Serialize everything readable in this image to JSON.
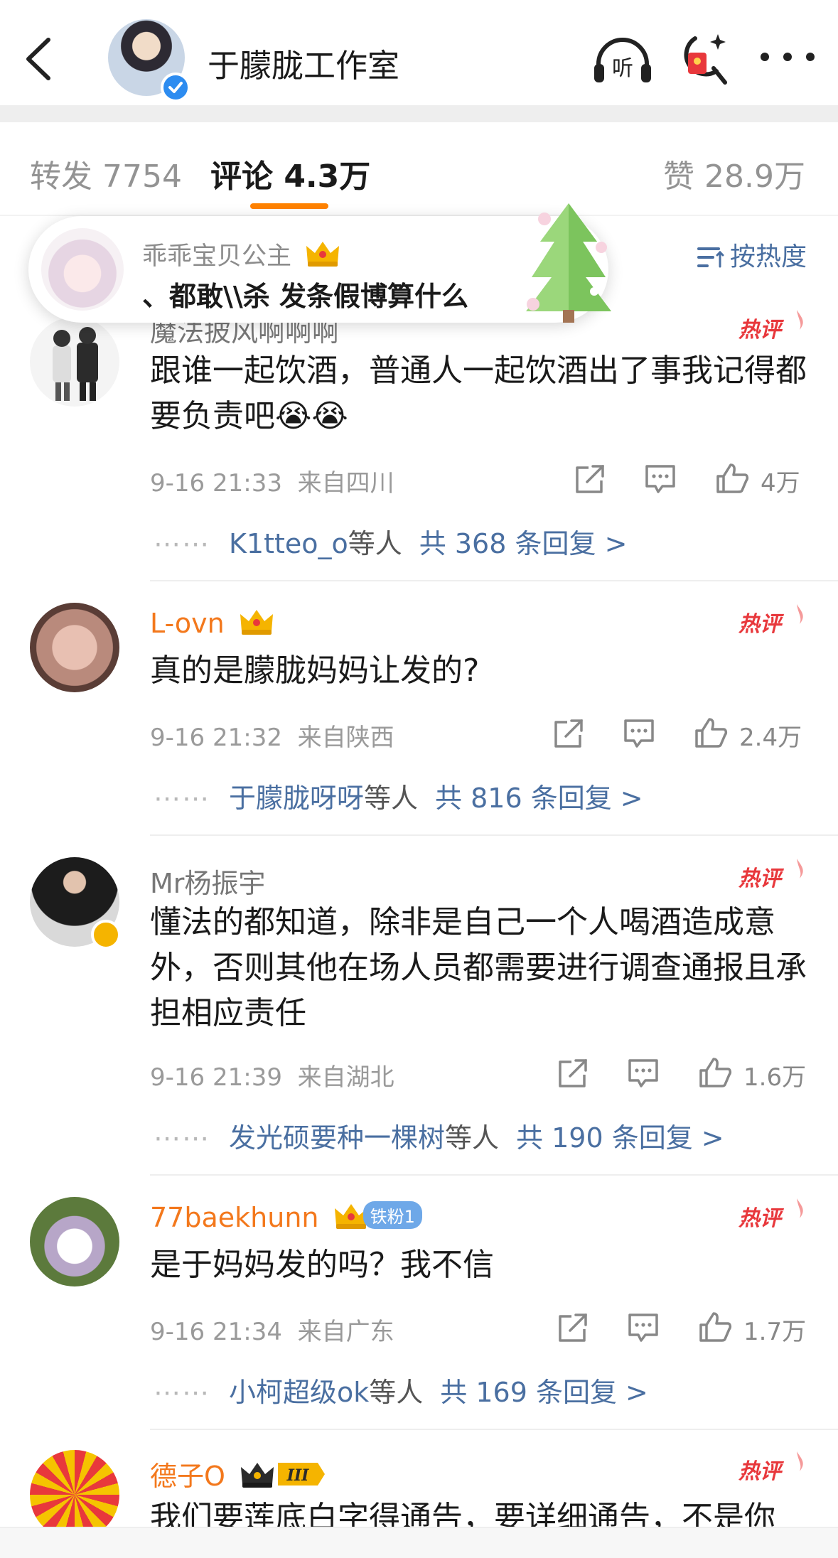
{
  "header": {
    "title": "于朦胧工作室"
  },
  "tabs": {
    "repost": "转发 7754",
    "comment": "评论 4.3万",
    "like": "赞 28.9万"
  },
  "sort": {
    "label": "按热度"
  },
  "bubble": {
    "name": "乖乖宝贝公主",
    "text": "、都敢\\\\杀 发条假博算什么"
  },
  "hot_tag": "热评",
  "comments": [
    {
      "name": "魔法披风啊啊啊",
      "text": "跟谁一起饮酒，普通人一起饮酒出了事我记得都要负责吧😭😭",
      "time": "9-16 21:33",
      "location": "来自四川",
      "likes": "4万",
      "reply_users": "K1tteo_o",
      "reply_suffix": "等人",
      "reply_total": "共 368 条回复 >"
    },
    {
      "name": "L-ovn",
      "text": "真的是朦胧妈妈让发的?",
      "time": "9-16 21:32",
      "location": "来自陕西",
      "likes": "2.4万",
      "reply_users": "于朦胧呀呀",
      "reply_suffix": "等人",
      "reply_total": "共 816 条回复 >"
    },
    {
      "name": "Mr杨振宇",
      "text": "懂法的都知道，除非是自己一个人喝酒造成意外，否则其他在场人员都需要进行调查通报且承担相应责任",
      "time": "9-16 21:39",
      "location": "来自湖北",
      "likes": "1.6万",
      "reply_users": "发光硕要种一棵树",
      "reply_suffix": "等人",
      "reply_total": "共 190 条回复 >"
    },
    {
      "name": "77baekhunn",
      "badge": "铁粉1",
      "text": "是于妈妈发的吗？我不信",
      "time": "9-16 21:34",
      "location": "来自广东",
      "likes": "1.7万",
      "reply_users": "小柯超级ok",
      "reply_suffix": "等人",
      "reply_total": "共 169 条回复 >"
    },
    {
      "name": "德子O",
      "level": "III",
      "text": "我们要莲底白字得通告，要详细通告，不是你"
    }
  ],
  "colors": {
    "accent": "#ff8200",
    "link": "#4a6fa1",
    "hot": "#e8383c",
    "name_orange": "#f3781c"
  }
}
